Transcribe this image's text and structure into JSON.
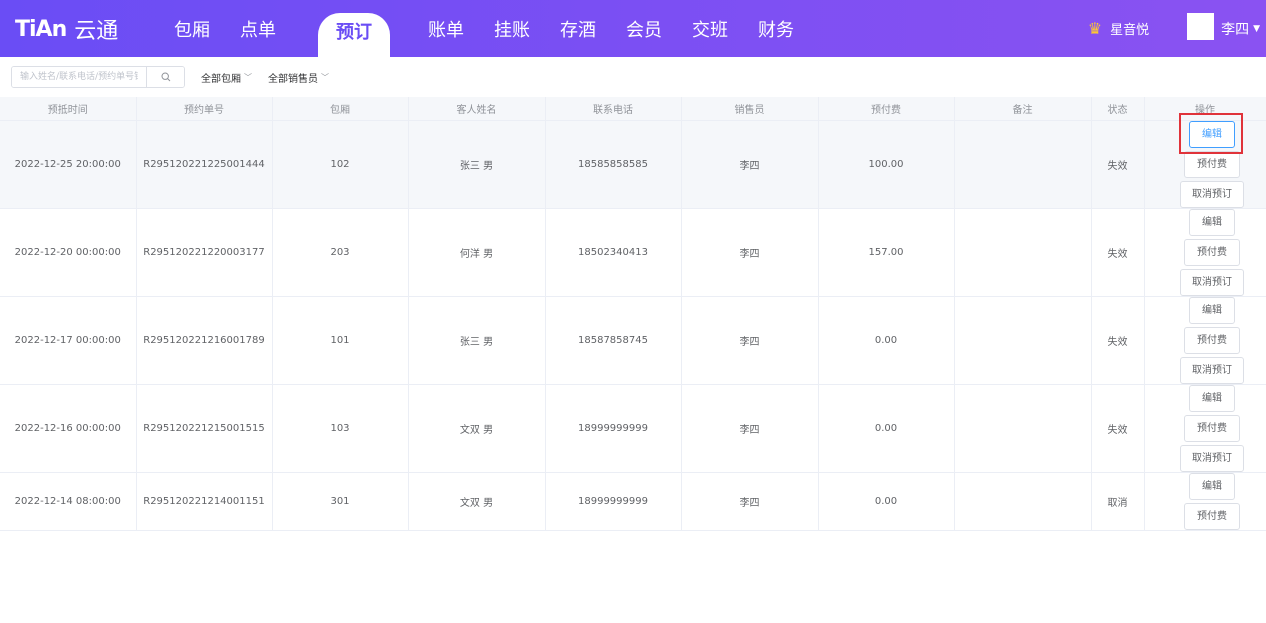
{
  "header": {
    "logo_mark": "TiAn",
    "logo_text": "云通",
    "nav": [
      "包厢",
      "点单",
      "预订",
      "账单",
      "挂账",
      "存酒",
      "会员",
      "交班",
      "财务"
    ],
    "active_nav": "预订",
    "store_name": "星音悦",
    "user_name": "李四"
  },
  "filters": {
    "search_placeholder": "输入姓名/联系电话/预约单号银",
    "room_filter": "全部包厢",
    "seller_filter": "全部销售员"
  },
  "table": {
    "columns": [
      "预抵时间",
      "预约单号",
      "包厢",
      "客人姓名",
      "联系电话",
      "销售员",
      "预付费",
      "备注",
      "状态",
      "操作"
    ],
    "rows": [
      {
        "time": "2022-12-25 20:00:00",
        "order": "R295120221225001444",
        "room": "102",
        "guest": "张三  男",
        "phone": "18585858585",
        "seller": "李四",
        "prepaid": "100.00",
        "note": "",
        "status": "失效",
        "actions": [
          "编辑",
          "预付费",
          "取消预订"
        ]
      },
      {
        "time": "2022-12-20 00:00:00",
        "order": "R295120221220003177",
        "room": "203",
        "guest": "何洋  男",
        "phone": "18502340413",
        "seller": "李四",
        "prepaid": "157.00",
        "note": "",
        "status": "失效",
        "actions": [
          "编辑",
          "预付费",
          "取消预订"
        ]
      },
      {
        "time": "2022-12-17 00:00:00",
        "order": "R295120221216001789",
        "room": "101",
        "guest": "张三  男",
        "phone": "18587858745",
        "seller": "李四",
        "prepaid": "0.00",
        "note": "",
        "status": "失效",
        "actions": [
          "编辑",
          "预付费",
          "取消预订"
        ]
      },
      {
        "time": "2022-12-16 00:00:00",
        "order": "R295120221215001515",
        "room": "103",
        "guest": "文双  男",
        "phone": "18999999999",
        "seller": "李四",
        "prepaid": "0.00",
        "note": "",
        "status": "失效",
        "actions": [
          "编辑",
          "预付费",
          "取消预订"
        ]
      },
      {
        "time": "2022-12-14 08:00:00",
        "order": "R295120221214001151",
        "room": "301",
        "guest": "文双  男",
        "phone": "18999999999",
        "seller": "李四",
        "prepaid": "0.00",
        "note": "",
        "status": "取消",
        "actions": [
          "编辑",
          "预付费"
        ]
      }
    ]
  },
  "colors": {
    "header_gradient_start": "#6a4df5",
    "header_gradient_end": "#8a52f2",
    "primary_blue": "#409eff",
    "highlight_red": "#e0333a"
  }
}
